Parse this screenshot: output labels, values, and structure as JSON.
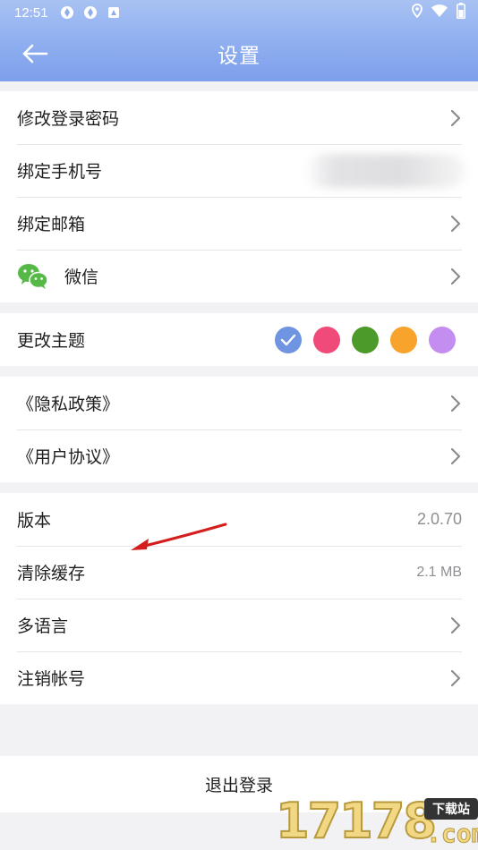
{
  "status_bar": {
    "time": "12:51",
    "left_icons": [
      "sync-icon",
      "sync-icon",
      "app-notification-icon"
    ],
    "right_icons": [
      "location-icon",
      "wifi-icon",
      "battery-icon"
    ]
  },
  "app_bar": {
    "title": "设置",
    "back_icon": "arrow-left-icon"
  },
  "account_group": [
    {
      "label": "修改登录密码",
      "right": "chevron"
    },
    {
      "label": "绑定手机号",
      "right": "blurred"
    },
    {
      "label": "绑定邮箱",
      "right": "chevron"
    },
    {
      "label": "微信",
      "right": "chevron",
      "icon": "wechat-icon"
    }
  ],
  "theme": {
    "label": "更改主题",
    "colors": [
      "#6f95e2",
      "#f04b78",
      "#4c9a2a",
      "#f8a32b",
      "#c48ef0"
    ],
    "selected_index": 0
  },
  "legal_group": [
    {
      "label": "《隐私政策》"
    },
    {
      "label": "《用户协议》"
    }
  ],
  "misc_group": {
    "version": {
      "label": "版本",
      "value": "2.0.70"
    },
    "cache": {
      "label": "清除缓存",
      "value": "2.1 MB"
    },
    "language": {
      "label": "多语言"
    },
    "delete_account": {
      "label": "注销帐号"
    }
  },
  "logout_label": "退出登录",
  "watermark": {
    "digits": "17178",
    "badge": "下载站",
    "domain": ".com"
  }
}
